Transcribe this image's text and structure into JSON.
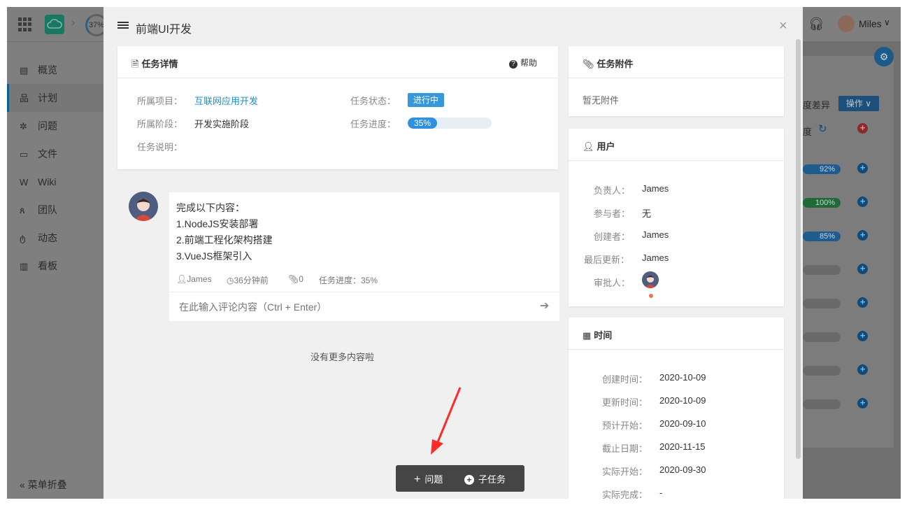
{
  "topbar": {
    "progress": "37%",
    "user_name": "Miles"
  },
  "sidebar": {
    "items": [
      {
        "label": "概览",
        "icon": "overview-icon"
      },
      {
        "label": "计划",
        "icon": "sitemap-icon"
      },
      {
        "label": "问题",
        "icon": "bug-icon"
      },
      {
        "label": "文件",
        "icon": "folder-icon"
      },
      {
        "label": "Wiki",
        "icon": "wiki-icon"
      },
      {
        "label": "团队",
        "icon": "team-icon"
      },
      {
        "label": "动态",
        "icon": "activity-icon"
      },
      {
        "label": "看板",
        "icon": "chart-icon"
      }
    ],
    "active_index": 1,
    "collapse_label": "菜单折叠"
  },
  "background": {
    "col_diff": "度差异",
    "col_progress": "度",
    "op_button": "操作",
    "bars": [
      "92%",
      "100%",
      "85%"
    ]
  },
  "modal": {
    "title": "前端UI开发",
    "detail": {
      "heading": "任务详情",
      "help": "帮助",
      "project_label": "所属项目：",
      "project_value": "互联网应用开发",
      "stage_label": "所属阶段：",
      "stage_value": "开发实施阶段",
      "desc_label": "任务说明：",
      "status_label": "任务状态：",
      "status_value": "进行中",
      "progress_label": "任务进度：",
      "progress_value": "35%",
      "progress_fraction": 0.35
    },
    "comment": {
      "lines": [
        "完成以下内容：",
        "1.NodeJS安装部署",
        "2.前端工程化架构搭建",
        "3.VueJS框架引入"
      ],
      "author": "James",
      "time": "36分钟前",
      "attachments": "0",
      "progress": "任务进度：35%",
      "input_placeholder": "在此输入评论内容（Ctrl + Enter）"
    },
    "no_more": "没有更多内容啦",
    "actions": {
      "issue": "问题",
      "subtask": "子任务"
    },
    "attachments": {
      "heading": "任务附件",
      "empty": "暂无附件"
    },
    "users": {
      "heading": "用户",
      "owner_label": "负责人：",
      "owner_value": "James",
      "participants_label": "参与者：",
      "participants_value": "无",
      "creator_label": "创建者：",
      "creator_value": "James",
      "updater_label": "最后更新：",
      "updater_value": "James",
      "approver_label": "审批人："
    },
    "time": {
      "heading": "时间",
      "created_label": "创建时间：",
      "created_value": "2020-10-09",
      "updated_label": "更新时间：",
      "updated_value": "2020-10-09",
      "planned_start_label": "预计开始：",
      "planned_start_value": "2020-09-10",
      "deadline_label": "截止日期：",
      "deadline_value": "2020-11-15",
      "actual_start_label": "实际开始：",
      "actual_start_value": "2020-09-30",
      "actual_finish_label": "实际完成：",
      "actual_finish_value": "-"
    }
  },
  "colors": {
    "accent": "#3498db",
    "link": "#1a8fc9",
    "annotation_arrow": "#ff2a2a"
  }
}
